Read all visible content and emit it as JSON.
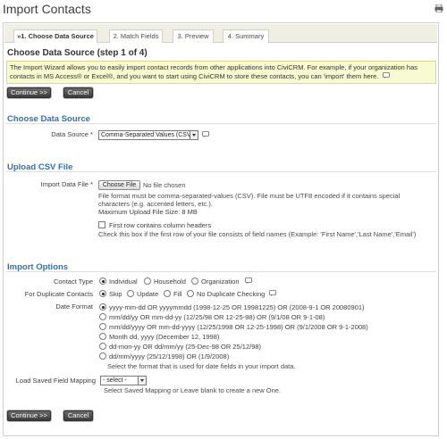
{
  "page": {
    "title": "Import Contacts",
    "print_icon": "printer-icon"
  },
  "wizard": {
    "tabs": [
      {
        "label": "»1. Choose Data Source",
        "active": true
      },
      {
        "label": "2. Match Fields",
        "active": false
      },
      {
        "label": "3. Preview",
        "active": false
      },
      {
        "label": "4. Summary",
        "active": false
      }
    ],
    "step_title": "Choose Data Source (step 1 of 4)",
    "intro": "The Import Wizard allows you to easily import contact records from other applications into CiviCRM. For example, if your organization has contacts in MS Access® or Excel®, and you want to start using CiviCRM to store these contacts, you can 'import' them here."
  },
  "buttons": {
    "continue": "Continue >>",
    "cancel": "Cancel"
  },
  "data_source": {
    "section_title": "Choose Data Source",
    "label": "Data Source",
    "required_mark": "*",
    "selected": "Comma-Separated Values (CSV)"
  },
  "upload": {
    "section_title": "Upload CSV File",
    "label": "Import Data File",
    "required_mark": "*",
    "choose_file": "Choose File",
    "no_file": "No file chosen",
    "help_line1": "File format must be comma-separated-values (CSV). File must be UTF8 encoded if it contains special",
    "help_line2": "characters (e.g. accented letters, etc.).",
    "max_size": "Maximum Upload File Size: 8 MB",
    "first_row_label": "First row contains column headers",
    "first_row_help": "Check this box if the first row of your file consists of field names (Example: 'First Name','Last Name','Email')",
    "first_row_checked": false
  },
  "import_options": {
    "section_title": "Import Options",
    "contact_type": {
      "label": "Contact Type",
      "options": [
        "Individual",
        "Household",
        "Organization"
      ],
      "selected": "Individual"
    },
    "duplicates": {
      "label": "For Duplicate Contacts",
      "options": [
        "Skip",
        "Update",
        "Fill",
        "No Duplicate Checking"
      ],
      "selected": "Skip"
    },
    "date_format": {
      "label": "Date Format",
      "options": [
        "yyyy-mm-dd OR yyyymmdd (1998-12-25 OR 19981225) OR (2008-9-1 OR 20080901)",
        "mm/dd/yy OR mm-dd-yy (12/25/98 OR 12-25-98) OR (9/1/08 OR 9-1-08)",
        "mm/dd/yyyy OR mm-dd-yyyy (12/25/1998 OR 12-25-1998) OR (9/1/2008 OR 9-1-2008)",
        "Month dd, yyyy (December 12, 1998)",
        "dd-mon-yy OR dd/mm/yy (25-Dec-98 OR 25/12/98)",
        "dd/mm/yyyy (25/12/1998) OR (1/9/2008)"
      ],
      "selected_index": 0,
      "help": "Select the format that is used for date fields in your import data."
    },
    "saved_mapping": {
      "label": "Load Saved Field Mapping",
      "selected": "- select -",
      "help": "Select Saved Mapping or Leave blank to create a new One."
    }
  }
}
